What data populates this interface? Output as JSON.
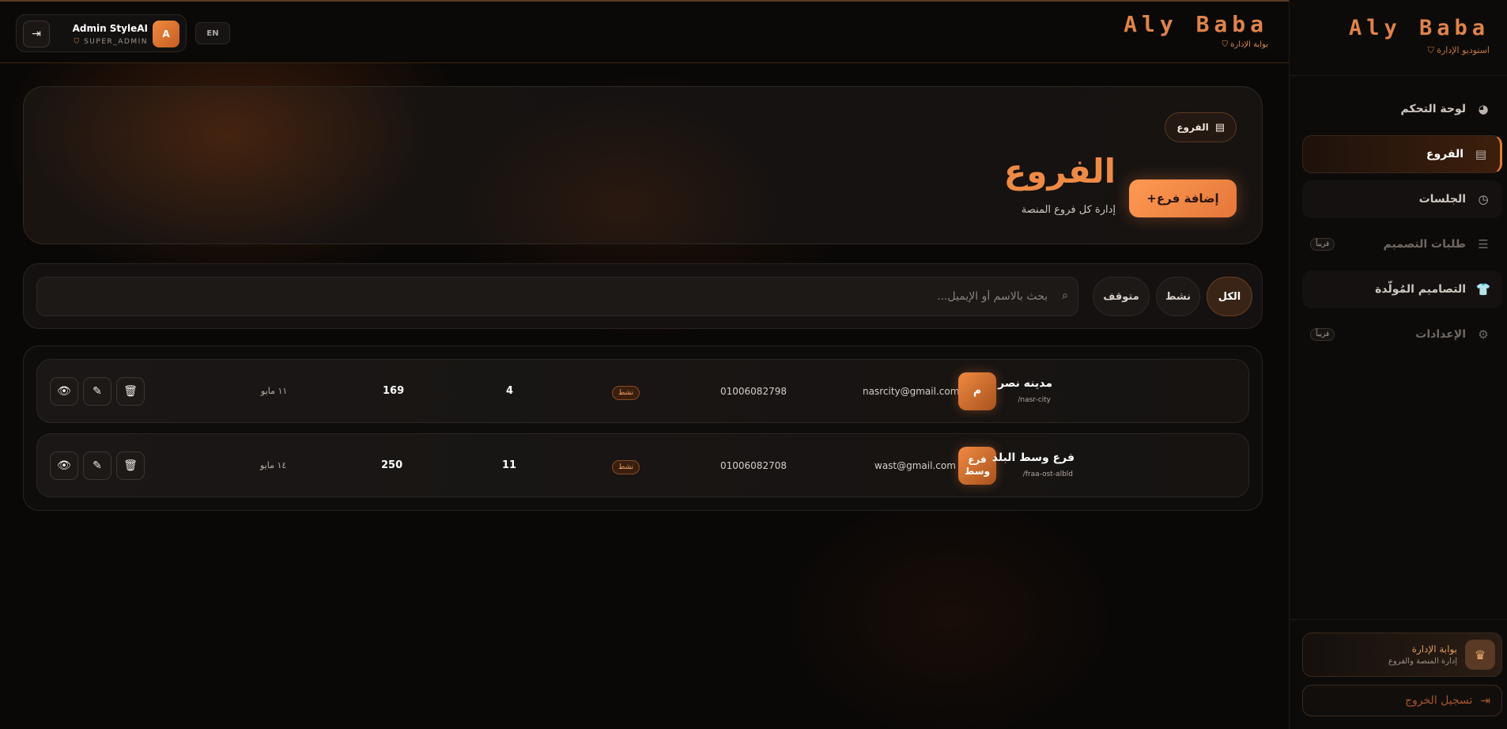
{
  "sidebar": {
    "brand": "Aly Baba",
    "subtitle": "استوديو الإدارة",
    "items": [
      {
        "label": "لوحة التحكم",
        "icon": "pie-chart-icon",
        "glyph": "◕"
      },
      {
        "label": "الفروع",
        "icon": "store-icon",
        "glyph": "▤"
      },
      {
        "label": "الجلسات",
        "icon": "clock-icon",
        "glyph": "◷"
      },
      {
        "label": "طلبات التصميم",
        "icon": "checklist-icon",
        "glyph": "☰",
        "badge": "قريباً"
      },
      {
        "label": "التصاميم المُولّدة",
        "icon": "tshirt-icon",
        "glyph": "👕"
      },
      {
        "label": "الإعدادات",
        "icon": "gear-icon",
        "glyph": "⚙",
        "badge": "قريباً"
      }
    ],
    "portal": {
      "title": "بوابة الإدارة",
      "subtitle": "إدارة المنصة والفروع",
      "glyph": "♛"
    },
    "logout": {
      "label": "تسجيل الخروج",
      "glyph": "⇥"
    }
  },
  "topbar": {
    "user_name": "Admin StyleAI",
    "user_role": "SUPER_ADMIN",
    "avatar_letter": "A",
    "lang_button": "EN",
    "brand": "Aly Baba",
    "brand_sub": "بوابة الإدارة",
    "logout_glyph": "⇥"
  },
  "hero": {
    "breadcrumb": "الفروع",
    "breadcrumb_glyph": "▤",
    "title": "الفروع",
    "subtitle": "إدارة كل فروع المنصة",
    "add_button": "+إضافة فرع"
  },
  "filters": {
    "search_placeholder": "بحث بالاسم أو الإيميل...",
    "search_glyph": "⌕",
    "tabs": [
      "الكل",
      "نشط",
      "متوقف"
    ],
    "active_tab": "الكل"
  },
  "branches": [
    {
      "avatar": "م",
      "name": "مدينه نصر",
      "slug": "/nasr-city",
      "email": "nasrcity@gmail.com",
      "phone": "01006082798",
      "status": "نشط",
      "count_a": "4",
      "count_b": "169",
      "date": "١١ مايو"
    },
    {
      "avatar": "فرع وسط",
      "name": "فرع وسط البلد",
      "slug": "/fraa-ost-albld",
      "email": "wast@gmail.com",
      "phone": "01006082708",
      "status": "نشط",
      "count_a": "11",
      "count_b": "250",
      "date": "١٤ مايو"
    }
  ],
  "row_actions": {
    "view": "👁",
    "edit": "✎",
    "delete": "🗑"
  },
  "colors": {
    "accent": "#e0834a",
    "button": "#ff9a52",
    "background": "#0a0807"
  }
}
